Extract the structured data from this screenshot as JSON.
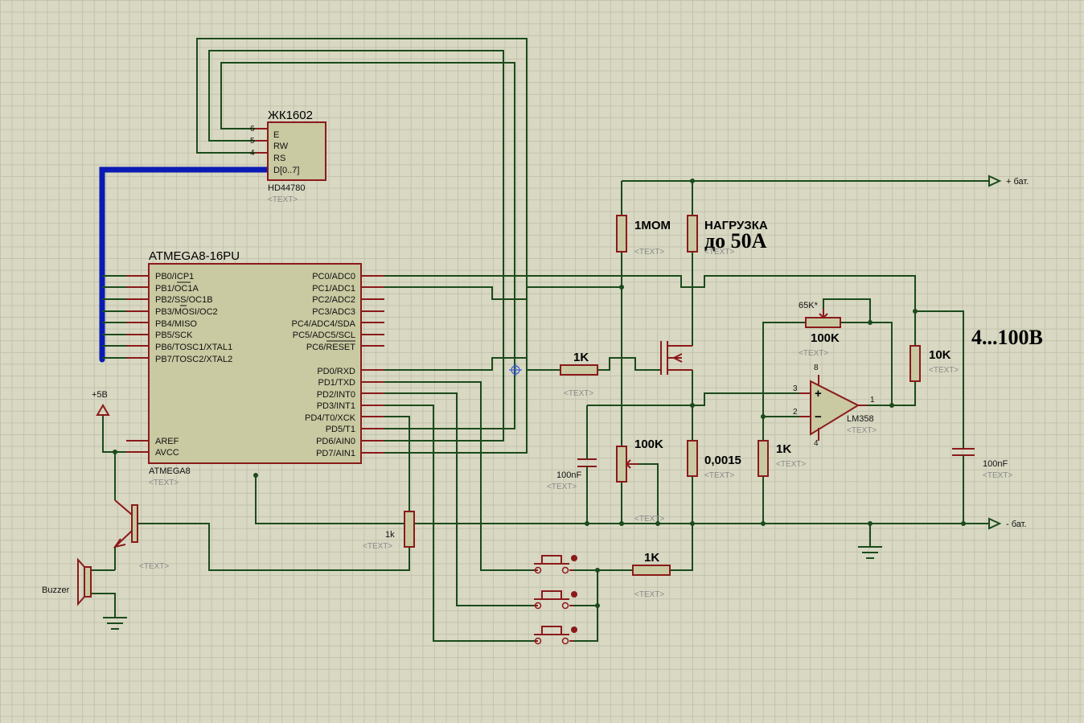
{
  "lcd": {
    "ref": "ЖК1602",
    "part": "HD44780",
    "placeholder": "<TEXT>",
    "pins": [
      {
        "num": "6",
        "name": "E"
      },
      {
        "num": "5",
        "name": "RW"
      },
      {
        "num": "4",
        "name": "RS"
      },
      {
        "name": "D[0..7]"
      }
    ]
  },
  "mcu": {
    "ref": "ATMEGA8-16PU",
    "part": "ATMEGA8",
    "placeholder": "<TEXT>",
    "left_pins": [
      "PB0/ICP1",
      "PB1/OC1A",
      "PB2/SS/OC1B",
      "PB3/MOSI/OC2",
      "PB4/MISO",
      "PB5/SCK",
      "PB6/TOSC1/XTAL1",
      "PB7/TOSC2/XTAL2"
    ],
    "left_pins_bottom": [
      "AREF",
      "AVCC"
    ],
    "right_pins_top": [
      "PC0/ADC0",
      "PC1/ADC1",
      "PC2/ADC2",
      "PC3/ADC3",
      "PC4/ADC4/SDA",
      "PC5/ADC5/SCL",
      "PC6/RESET"
    ],
    "right_pins_bottom": [
      "PD0/RXD",
      "PD1/TXD",
      "PD2/INT0",
      "PD3/INT1",
      "PD4/T0/XCK",
      "PD5/T1",
      "PD6/AIN0",
      "PD7/AIN1"
    ]
  },
  "power": {
    "vcc_label": "+5B",
    "bat_plus": "+ бат.",
    "bat_minus": "- бат."
  },
  "components": {
    "r_1mom": "1MOM",
    "load_line1": "НАГРУЗКА",
    "load_line2": "до 50А",
    "r_65k_star": "65K*",
    "pot_100k_top": "100K",
    "voltage_range": "4...100B",
    "r_1k_gate": "1K",
    "r_10k": "10K",
    "opamp": "LM358",
    "opamp_pins": {
      "plus": "3",
      "minus": "2",
      "out": "1",
      "vplus": "8",
      "vminus": "4"
    },
    "pot_100k_mid": "100K",
    "c_100nf_left": "100nF",
    "shunt": "0,0015",
    "r_1k_opamp": "1K",
    "c_100nf_right": "100nF",
    "r_1k_base": "1k",
    "r_1k_buttons": "1K",
    "buzzer": "Buzzer",
    "placeholder": "<TEXT>"
  }
}
